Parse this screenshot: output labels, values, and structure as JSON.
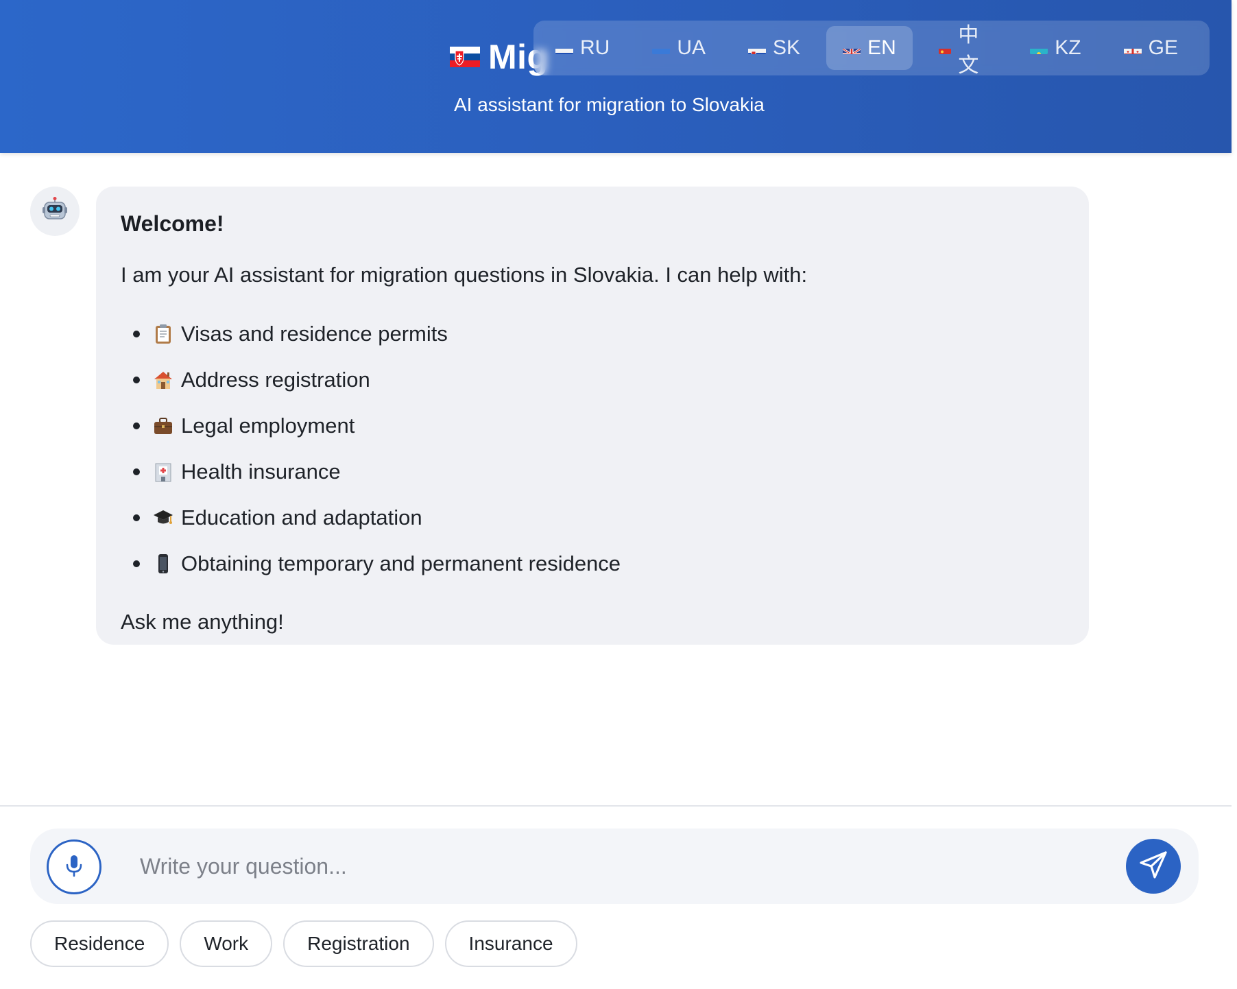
{
  "header": {
    "title": "Mig",
    "subtitle": "AI assistant for migration to Slovakia",
    "languages": [
      {
        "code": "RU",
        "label": "RU",
        "active": false
      },
      {
        "code": "UA",
        "label": "UA",
        "active": false
      },
      {
        "code": "SK",
        "label": "SK",
        "active": false
      },
      {
        "code": "EN",
        "label": "EN",
        "active": true
      },
      {
        "code": "ZH",
        "label": "中文",
        "active": false
      },
      {
        "code": "KZ",
        "label": "KZ",
        "active": false
      },
      {
        "code": "GE",
        "label": "GE",
        "active": false
      }
    ]
  },
  "message": {
    "sender_icon": "robot-icon",
    "heading": "Welcome!",
    "intro": "I am your AI assistant for migration questions in Slovakia. I can help with:",
    "topics": [
      {
        "icon": "clipboard-icon",
        "label": "Visas and residence permits"
      },
      {
        "icon": "house-icon",
        "label": "Address registration"
      },
      {
        "icon": "briefcase-icon",
        "label": "Legal employment"
      },
      {
        "icon": "hospital-icon",
        "label": "Health insurance"
      },
      {
        "icon": "graduation-cap-icon",
        "label": "Education and adaptation"
      },
      {
        "icon": "phone-icon",
        "label": "Obtaining temporary and permanent residence"
      }
    ],
    "closing": "Ask me anything!"
  },
  "composer": {
    "placeholder": "Write your question...",
    "value": "",
    "mic_icon": "microphone-icon",
    "send_icon": "send-icon"
  },
  "quick_replies": [
    "Residence",
    "Work",
    "Registration",
    "Insurance"
  ],
  "colors": {
    "header_start": "#2c67c9",
    "header_end": "#2756ad",
    "accent": "#2b63c4",
    "bubble_bg": "#f0f1f5"
  }
}
